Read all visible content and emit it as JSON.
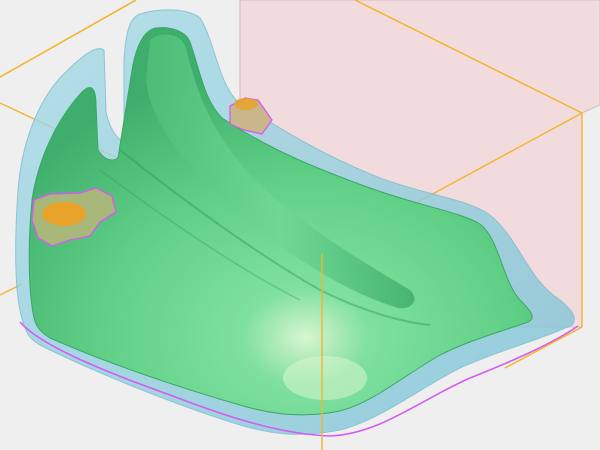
{
  "viewport": {
    "background": "#efefef",
    "colors": {
      "bounding_box": "#f5b32a",
      "back_wall": "#f3d9db",
      "back_wall_stroke": "#d8b8bb",
      "outer_shell": "#8fd0df",
      "outer_shell_dark": "#6fb8cc",
      "solid_part": "#5fcf85",
      "solid_part_dark": "#39a866",
      "highlight": "#d9f5d0",
      "trim_outline": "#d45cf0",
      "contact_pad": "#e8a32a"
    }
  },
  "scene": {
    "objects": [
      {
        "name": "bounding-box-frame",
        "icon": "wireframe-box"
      },
      {
        "name": "transparent-back-wall",
        "icon": "plane"
      },
      {
        "name": "outer-offset-shell",
        "icon": "translucent-solid"
      },
      {
        "name": "green-molded-part",
        "icon": "solid"
      },
      {
        "name": "trim-outline",
        "icon": "curve"
      },
      {
        "name": "contact-pad-left",
        "icon": "patch"
      },
      {
        "name": "contact-pad-top",
        "icon": "patch"
      }
    ]
  }
}
